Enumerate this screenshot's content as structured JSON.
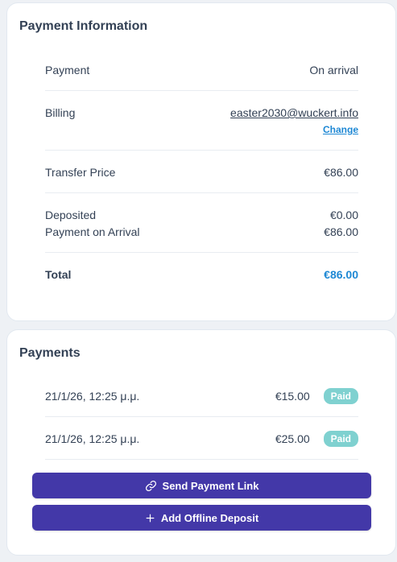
{
  "payment_information": {
    "title": "Payment Information",
    "payment": {
      "label": "Payment",
      "value": "On arrival"
    },
    "billing": {
      "label": "Billing",
      "email": "easter2030@wuckert.info",
      "change_label": "Change"
    },
    "transfer_price": {
      "label": "Transfer Price",
      "value": "€86.00"
    },
    "deposited": {
      "label": "Deposited",
      "value": "€0.00"
    },
    "payment_on_arrival": {
      "label": "Payment on Arrival",
      "value": "€86.00"
    },
    "total": {
      "label": "Total",
      "value": "€86.00"
    }
  },
  "payments": {
    "title": "Payments",
    "rows": [
      {
        "date": "21/1/26, 12:25 μ.μ.",
        "amount": "€15.00",
        "status": "Paid"
      },
      {
        "date": "21/1/26, 12:25 μ.μ.",
        "amount": "€25.00",
        "status": "Paid"
      }
    ],
    "send_link_label": "Send Payment Link",
    "add_deposit_label": "Add Offline Deposit"
  },
  "colors": {
    "accent": "#4338a8",
    "link": "#1e88d4",
    "paid_badge": "#7fd1d0"
  },
  "icons": {
    "send_link": "link-icon",
    "add_deposit": "plus-icon"
  }
}
